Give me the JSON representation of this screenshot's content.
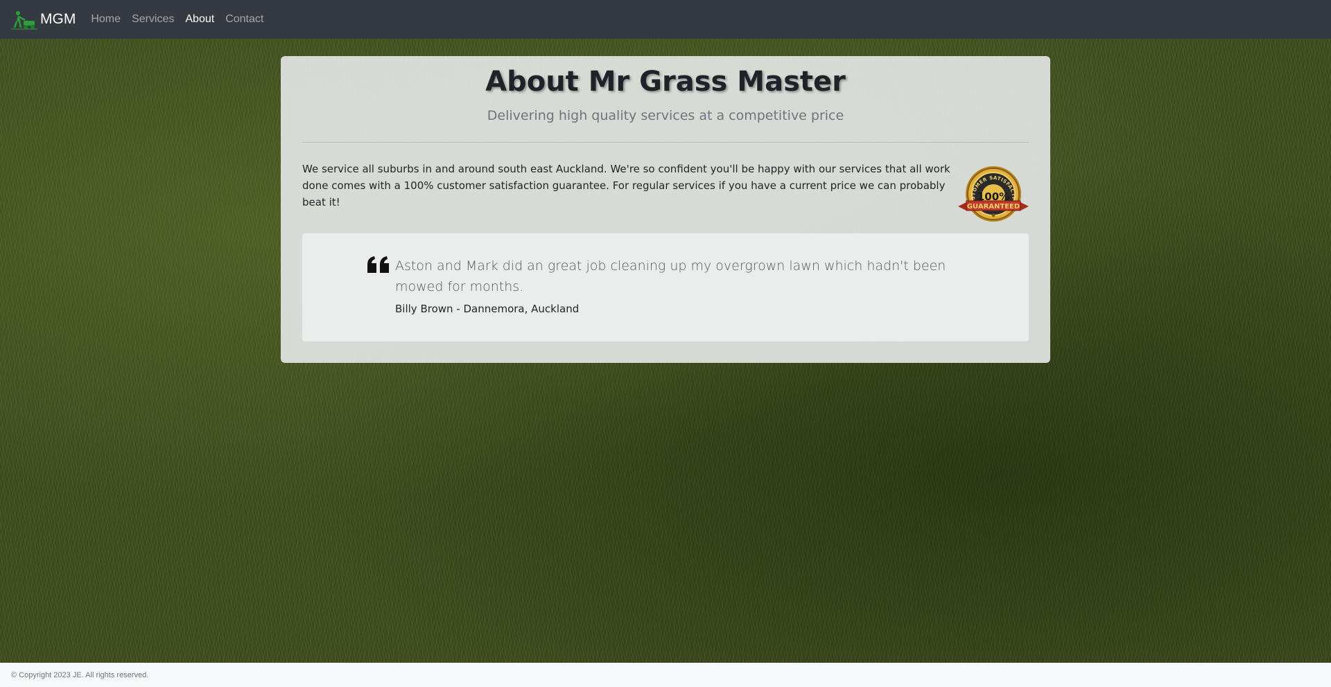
{
  "navbar": {
    "brand": "MGM",
    "brand_icon": "lawnmower-icon",
    "items": [
      {
        "label": "Home",
        "active": false
      },
      {
        "label": "Services",
        "active": false
      },
      {
        "label": "About",
        "active": true
      },
      {
        "label": "Contact",
        "active": false
      }
    ]
  },
  "about": {
    "title": "About Mr Grass Master",
    "subtitle": "Delivering high quality services at a competitive price",
    "intro": "We service all suburbs in and around south east Auckland. We're so confident you'll be happy with our services that all work done comes with a 100% customer satisfaction guarantee. For regular services if you have a current price we can probably beat it!",
    "badge": {
      "top_text": "CUSTOMER SATISFACTION",
      "center_text": "100%",
      "ribbon_text": "GUARANTEED"
    }
  },
  "testimonial": {
    "icon": "quote-icon",
    "text": "Aston and Mark did an great job cleaning up my overgrown lawn which hadn't been mowed for months.",
    "author": "Billy Brown - Dannemora, Auckland"
  },
  "footer": {
    "copyright": "© Copyright 2023 JE. All rights reserved."
  },
  "colors": {
    "navbar_bg": "#343a40",
    "grass_base": "#3e4c20",
    "badge_gold": "#d4a017",
    "badge_ribbon": "#c0392b"
  }
}
